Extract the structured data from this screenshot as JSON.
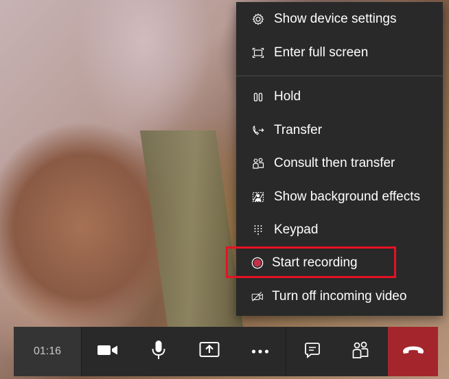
{
  "menu": {
    "items": [
      {
        "id": "show-device-settings",
        "label": "Show device settings",
        "icon": "gear-icon"
      },
      {
        "id": "enter-full-screen",
        "label": "Enter full screen",
        "icon": "fullscreen-icon"
      },
      {
        "id": "hold",
        "label": "Hold",
        "icon": "pause-icon"
      },
      {
        "id": "transfer",
        "label": "Transfer",
        "icon": "phone-transfer-icon"
      },
      {
        "id": "consult-then-transfer",
        "label": "Consult then transfer",
        "icon": "people-icon"
      },
      {
        "id": "show-background-effects",
        "label": "Show background effects",
        "icon": "background-effects-icon"
      },
      {
        "id": "keypad",
        "label": "Keypad",
        "icon": "keypad-icon"
      },
      {
        "id": "start-recording",
        "label": "Start recording",
        "icon": "record-icon"
      },
      {
        "id": "turn-off-incoming-video",
        "label": "Turn off incoming video",
        "icon": "video-off-icon"
      }
    ]
  },
  "call_bar": {
    "timer": "01:16",
    "controls": [
      {
        "id": "camera",
        "icon": "video-camera-icon"
      },
      {
        "id": "microphone",
        "icon": "microphone-icon"
      },
      {
        "id": "share",
        "icon": "share-screen-icon"
      },
      {
        "id": "more",
        "icon": "more-options-icon"
      },
      {
        "id": "chat",
        "icon": "chat-icon"
      },
      {
        "id": "participants",
        "icon": "participants-icon"
      },
      {
        "id": "hang-up",
        "icon": "hang-up-icon"
      }
    ]
  },
  "colors": {
    "menu_bg": "#292929",
    "bar_bg": "#292929",
    "hangup": "#a4262c",
    "highlight": "#e81123",
    "record_dot": "#c4314b"
  }
}
